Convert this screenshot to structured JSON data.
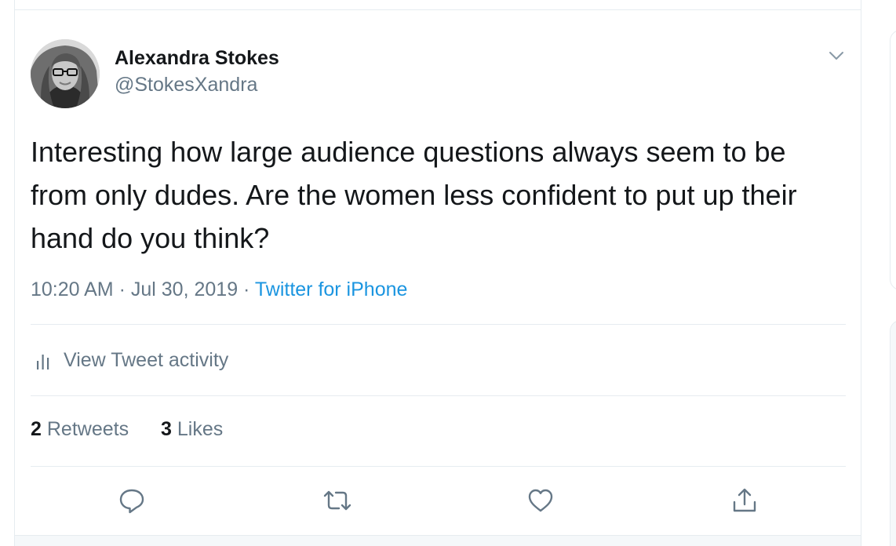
{
  "tweet": {
    "display_name": "Alexandra Stokes",
    "handle": "@StokesXandra",
    "text": "Interesting how large audience questions always seem to be from only dudes. Are the women less confident to put up their hand do you think?",
    "time": "10:20 AM",
    "separator": "·",
    "date": "Jul 30, 2019",
    "source": "Twitter for iPhone"
  },
  "activity": {
    "label": "View Tweet activity",
    "icon": "bar-chart-icon"
  },
  "stats": {
    "retweets_count": "2",
    "retweets_label": "Retweets",
    "likes_count": "3",
    "likes_label": "Likes"
  },
  "actions": {
    "reply_icon": "reply-icon",
    "retweet_icon": "retweet-icon",
    "like_icon": "heart-icon",
    "share_icon": "share-icon"
  },
  "colors": {
    "text_primary": "#14171a",
    "text_secondary": "#657786",
    "link": "#1b95e0",
    "border": "#e6ecf0"
  }
}
